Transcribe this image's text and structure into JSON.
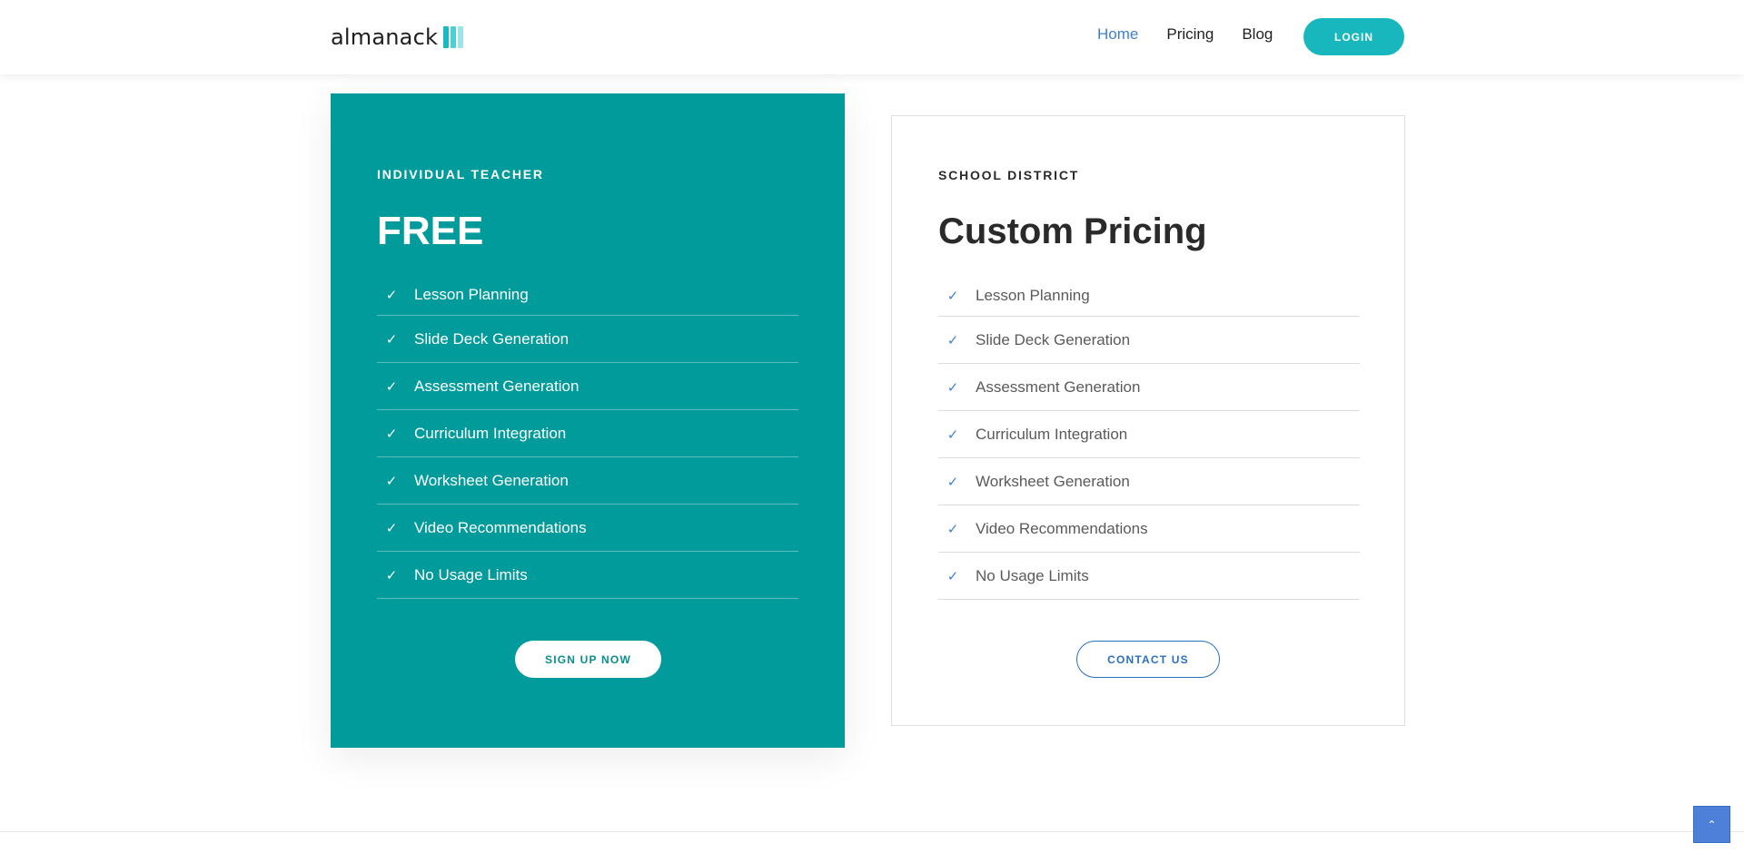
{
  "header": {
    "logo_text": "almanack",
    "nav": [
      {
        "label": "Home",
        "active": true
      },
      {
        "label": "Pricing",
        "active": false
      },
      {
        "label": "Blog",
        "active": false
      }
    ],
    "login_label": "LOGIN"
  },
  "plans": {
    "free": {
      "eyebrow": "INDIVIDUAL TEACHER",
      "price": "FREE",
      "features": [
        "Lesson Planning",
        "Slide Deck Generation",
        "Assessment Generation",
        "Curriculum Integration",
        "Worksheet Generation",
        "Video Recommendations",
        "No Usage Limits"
      ],
      "cta_label": "SIGN UP NOW"
    },
    "district": {
      "eyebrow": "SCHOOL DISTRICT",
      "price": "Custom Pricing",
      "features": [
        "Lesson Planning",
        "Slide Deck Generation",
        "Assessment Generation",
        "Curriculum Integration",
        "Worksheet Generation",
        "Video Recommendations",
        "No Usage Limits"
      ],
      "cta_label": "CONTACT US"
    }
  },
  "icons": {
    "check": "✓",
    "back_to_top": "⌃"
  },
  "colors": {
    "brand_teal": "#029b9b",
    "accent_teal": "#18b6bd",
    "link_blue": "#3f7fd6",
    "back_to_top_blue": "#4e7fd9"
  }
}
